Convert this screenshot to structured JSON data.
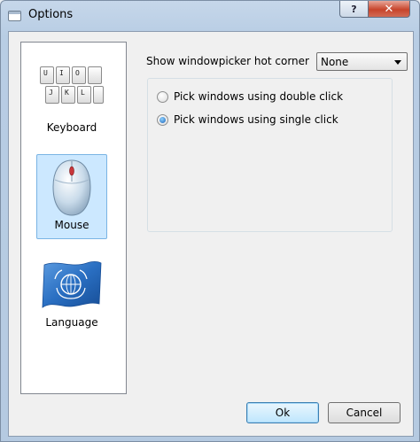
{
  "window": {
    "title": "Options",
    "help_label": "?",
    "close_label": "✕"
  },
  "sidebar": {
    "items": [
      {
        "label": "Keyboard",
        "icon": "keyboard-icon",
        "selected": false
      },
      {
        "label": "Mouse",
        "icon": "mouse-icon",
        "selected": true
      },
      {
        "label": "Language",
        "icon": "un-flag-icon",
        "selected": false
      }
    ],
    "keys": [
      "U",
      "I",
      "O",
      "J",
      "K",
      "L"
    ]
  },
  "settings": {
    "hot_corner_label": "Show windowpicker hot corner",
    "hot_corner_value": "None",
    "radio_options": [
      {
        "label": "Pick windows using double click",
        "checked": false
      },
      {
        "label": "Pick windows using single click",
        "checked": true
      }
    ]
  },
  "footer": {
    "ok_label": "Ok",
    "cancel_label": "Cancel"
  },
  "colors": {
    "selection_bg": "#cce8ff",
    "selection_border": "#7ab4e4",
    "close_button": "#c7442b"
  }
}
